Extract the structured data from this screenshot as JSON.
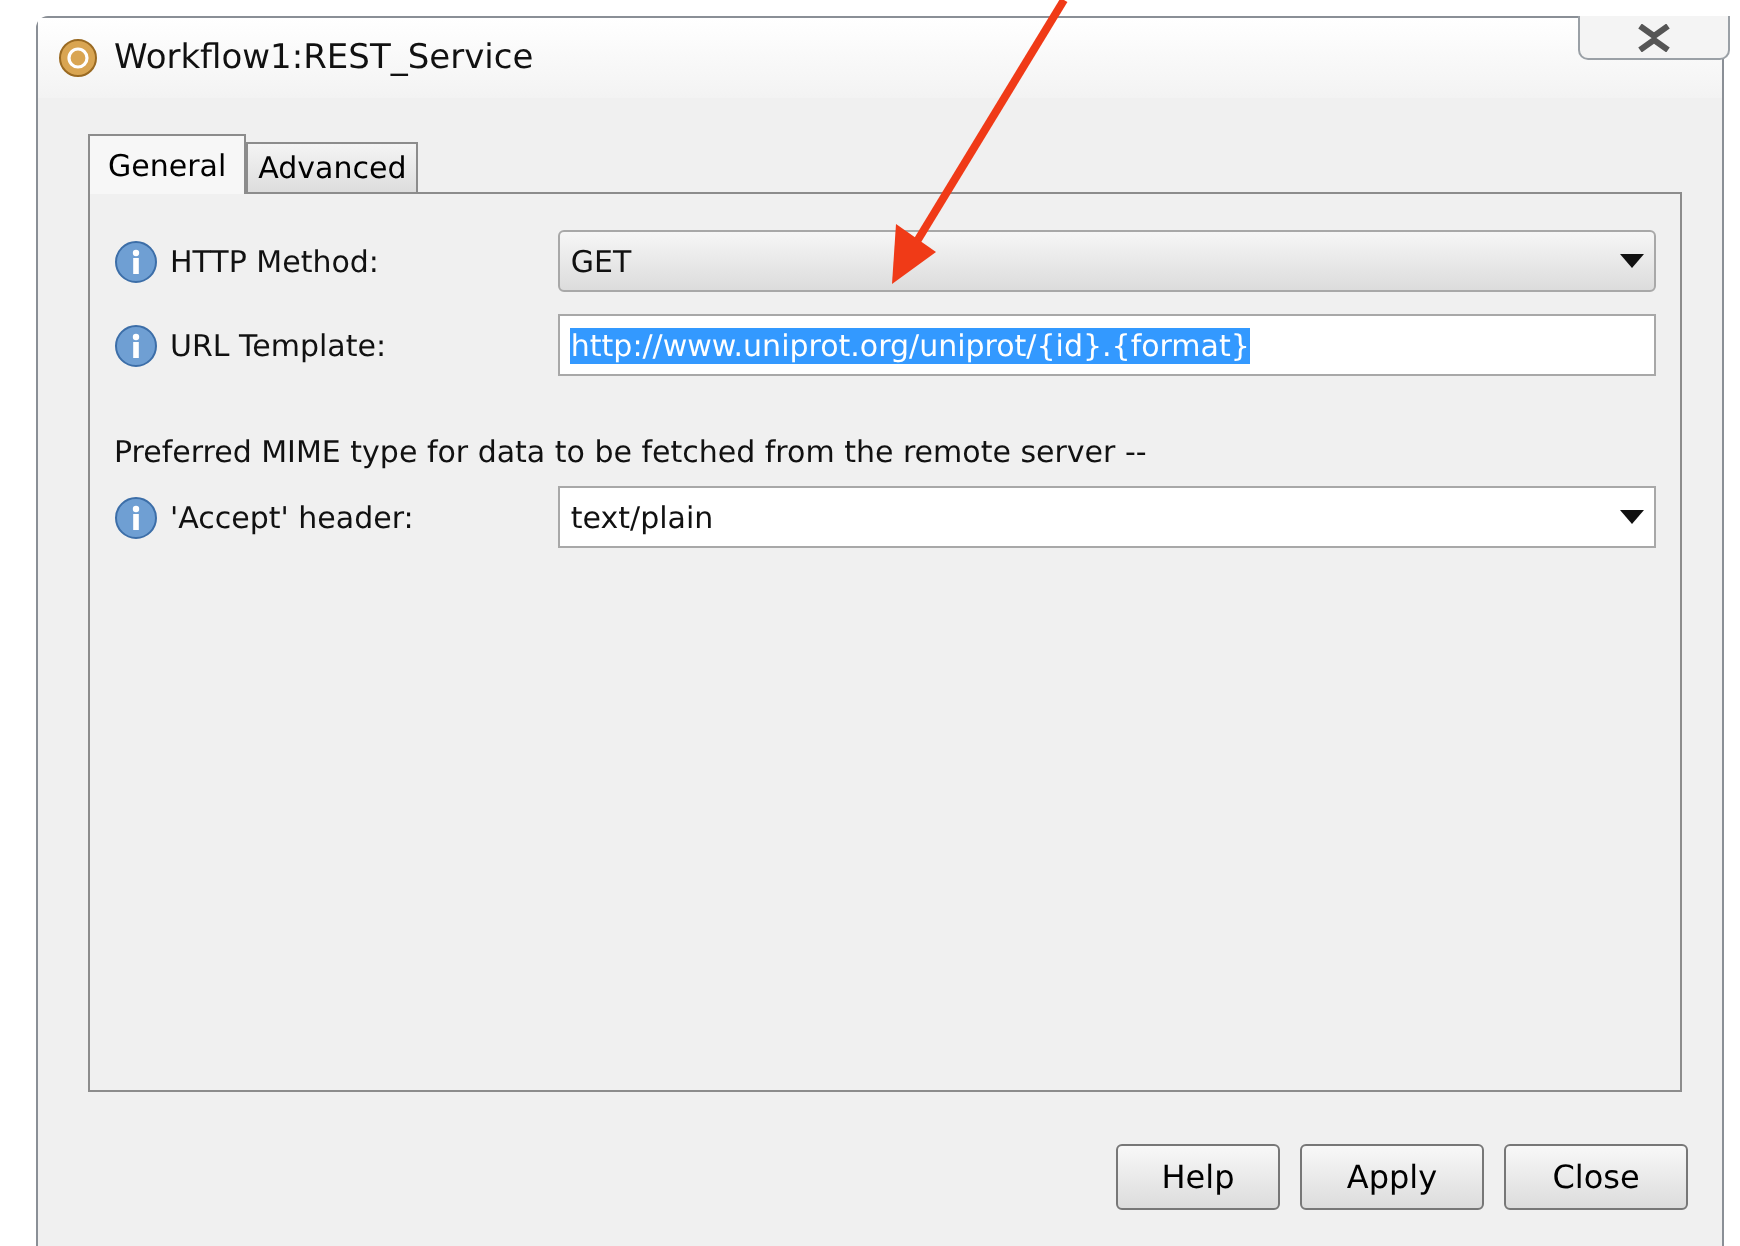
{
  "window": {
    "title": "Workflow1:REST_Service"
  },
  "tabs": [
    {
      "label": "General",
      "selected": true
    },
    {
      "label": "Advanced",
      "selected": false
    }
  ],
  "fields": [
    {
      "kind": "dropdown",
      "label": "HTTP Method:",
      "value": "GET"
    },
    {
      "kind": "text",
      "label": "URL Template:",
      "value": "http://www.uniprot.org/uniprot/{id}.{format}",
      "text_selected": true
    },
    {
      "kind": "note",
      "label": "Preferred MIME type for data to be fetched from the remote server --"
    },
    {
      "kind": "combo",
      "label": "'Accept' header:",
      "value": "text/plain"
    }
  ],
  "buttons": [
    "Help",
    "Apply",
    "Close"
  ]
}
